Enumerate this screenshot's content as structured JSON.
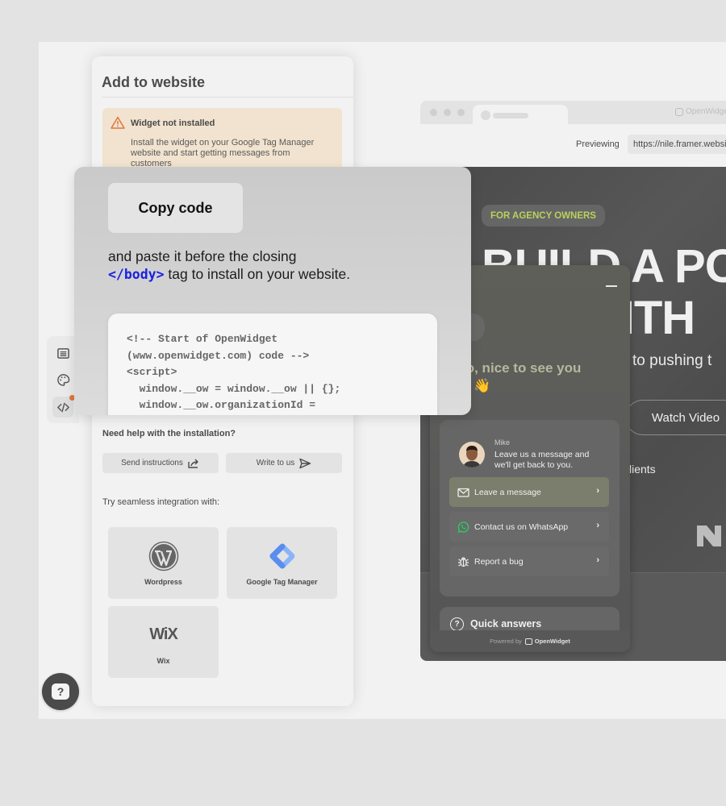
{
  "panel": {
    "title": "Add to website",
    "alert": {
      "icon": "warning-triangle-icon",
      "title": "Widget not installed",
      "text": "Install the widget on your Google Tag Manager website and start getting messages from customers"
    },
    "help": {
      "title": "Need help with the installation?",
      "send_label": "Send instructions",
      "write_label": "Write to us"
    },
    "integrations": {
      "title": "Try seamless integration with:",
      "items": [
        {
          "label": "Wordpress",
          "icon": "wordpress-logo-icon"
        },
        {
          "label": "Google Tag Manager",
          "icon": "google-tag-manager-logo-icon"
        },
        {
          "label": "Wix",
          "icon": "wix-logo-icon",
          "logo_text": "WiX"
        }
      ]
    }
  },
  "rail": {
    "items": [
      {
        "icon": "content-list-icon",
        "active": false
      },
      {
        "icon": "palette-icon",
        "active": false
      },
      {
        "icon": "code-icon",
        "active": true,
        "badge": true
      }
    ]
  },
  "help_fab": {
    "icon": "question-icon",
    "label": "?"
  },
  "overlay": {
    "copy_label": "Copy code",
    "paste_text_before": "and paste it before the closing",
    "paste_tag": "</body>",
    "paste_text_after": " tag to install on your website.",
    "code_lines": [
      "<!-- Start of OpenWidget",
      "(www.openwidget.com) code -->",
      "<script>",
      "  window.__ow = window.__ow || {};",
      "  window.__ow.organizationId ="
    ]
  },
  "browser": {
    "brand": "OpenWidget",
    "previewing_label": "Previewing",
    "url": "https://nile.framer.website/",
    "site": {
      "tag": "FOR AGENCY OWNERS",
      "headline_line1": "BUILD A PO",
      "headline_line2": "WITH",
      "subtitle": "to pushing t",
      "watch_label": "Watch Video",
      "clients_text": "lients"
    }
  },
  "chat": {
    "greeting_line1": "lo, nice to see you",
    "greeting_line2": "e 👋",
    "agent_name": "Mike",
    "agent_message": "Leave us a message and we'll get back to you.",
    "options": [
      {
        "label": "Leave a message",
        "icon": "mail-icon",
        "highlight": true
      },
      {
        "label": "Contact us on WhatsApp",
        "icon": "whatsapp-icon",
        "highlight": false
      },
      {
        "label": "Report a bug",
        "icon": "bug-icon",
        "highlight": false
      }
    ],
    "quick_answers": "Quick answers",
    "powered_by": "Powered by",
    "powered_brand": "OpenWidget"
  },
  "colors": {
    "alert_bg": "#f1e3cf",
    "alert_icon": "#e0763b",
    "tag_green": "#b9d15c",
    "code_tag_blue": "#1a21e0",
    "whatsapp_green": "#25d366"
  }
}
